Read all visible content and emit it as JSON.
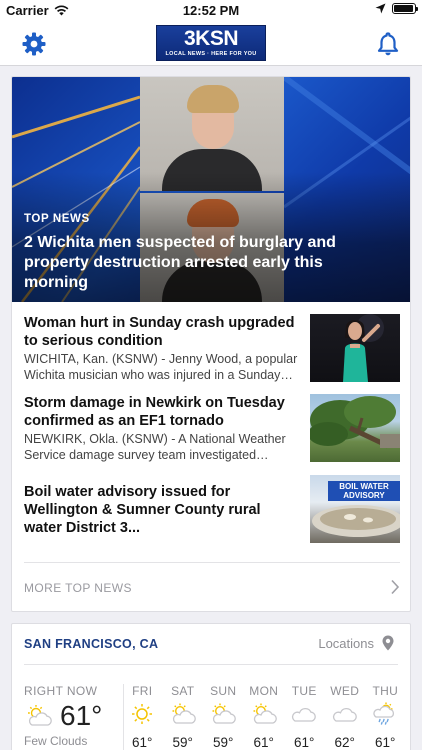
{
  "status_bar": {
    "carrier": "Carrier",
    "time": "12:52 PM",
    "battery_level": 0.95,
    "icons": [
      "wifi-icon",
      "location-arrow-icon",
      "battery-icon"
    ]
  },
  "nav": {
    "logo_text": "KSN",
    "logo_number": "3",
    "logo_tagline": "LOCAL NEWS · HERE FOR YOU",
    "left_icon": "gear-icon",
    "right_icon": "bell-icon"
  },
  "top_news": {
    "hero": {
      "kicker": "TOP NEWS",
      "headline": "2 Wichita men suspected of burglary and property destruction arrested early this morning"
    },
    "stories": [
      {
        "title": "Woman hurt in Sunday crash upgraded to serious condition",
        "summary": "WICHITA, Kan. (KSNW) - Jenny Wood, a popular Wichita musician who was injured in a Sunday crash…",
        "thumb": "singer-photo"
      },
      {
        "title": "Storm damage in Newkirk on Tuesday confirmed as an EF1 tornado",
        "summary": "NEWKIRK, Okla. (KSNW) - A National Weather Service damage survey team investigated…",
        "thumb": "fallen-tree-photo"
      },
      {
        "title": "Boil water advisory issued for Wellington & Sumner County rural water District 3...",
        "summary": "",
        "thumb": "boil-water-photo",
        "thumb_caption": "BOIL WATER ADVISORY"
      }
    ],
    "more_label": "MORE TOP NEWS"
  },
  "weather": {
    "location": "SAN FRANCISCO, CA",
    "locations_label": "Locations",
    "now": {
      "label": "RIGHT NOW",
      "temp": "61°",
      "condition": "Few Clouds",
      "icon": "partly-cloudy-icon"
    },
    "days": [
      {
        "label": "FRI",
        "temp": "61°",
        "icon": "sun-icon"
      },
      {
        "label": "SAT",
        "temp": "59°",
        "icon": "partly-cloudy-icon"
      },
      {
        "label": "SUN",
        "temp": "59°",
        "icon": "partly-cloudy-icon"
      },
      {
        "label": "MON",
        "temp": "61°",
        "icon": "partly-cloudy-icon"
      },
      {
        "label": "TUE",
        "temp": "61°",
        "icon": "cloud-icon"
      },
      {
        "label": "WED",
        "temp": "62°",
        "icon": "cloud-icon"
      },
      {
        "label": "THU",
        "temp": "61°",
        "icon": "rain-icon"
      }
    ]
  },
  "colors": {
    "accent_blue": "#1f5fc6",
    "location_blue": "#1f3f83",
    "sun_yellow": "#f5c400",
    "muted_gray": "#8e8e93"
  }
}
